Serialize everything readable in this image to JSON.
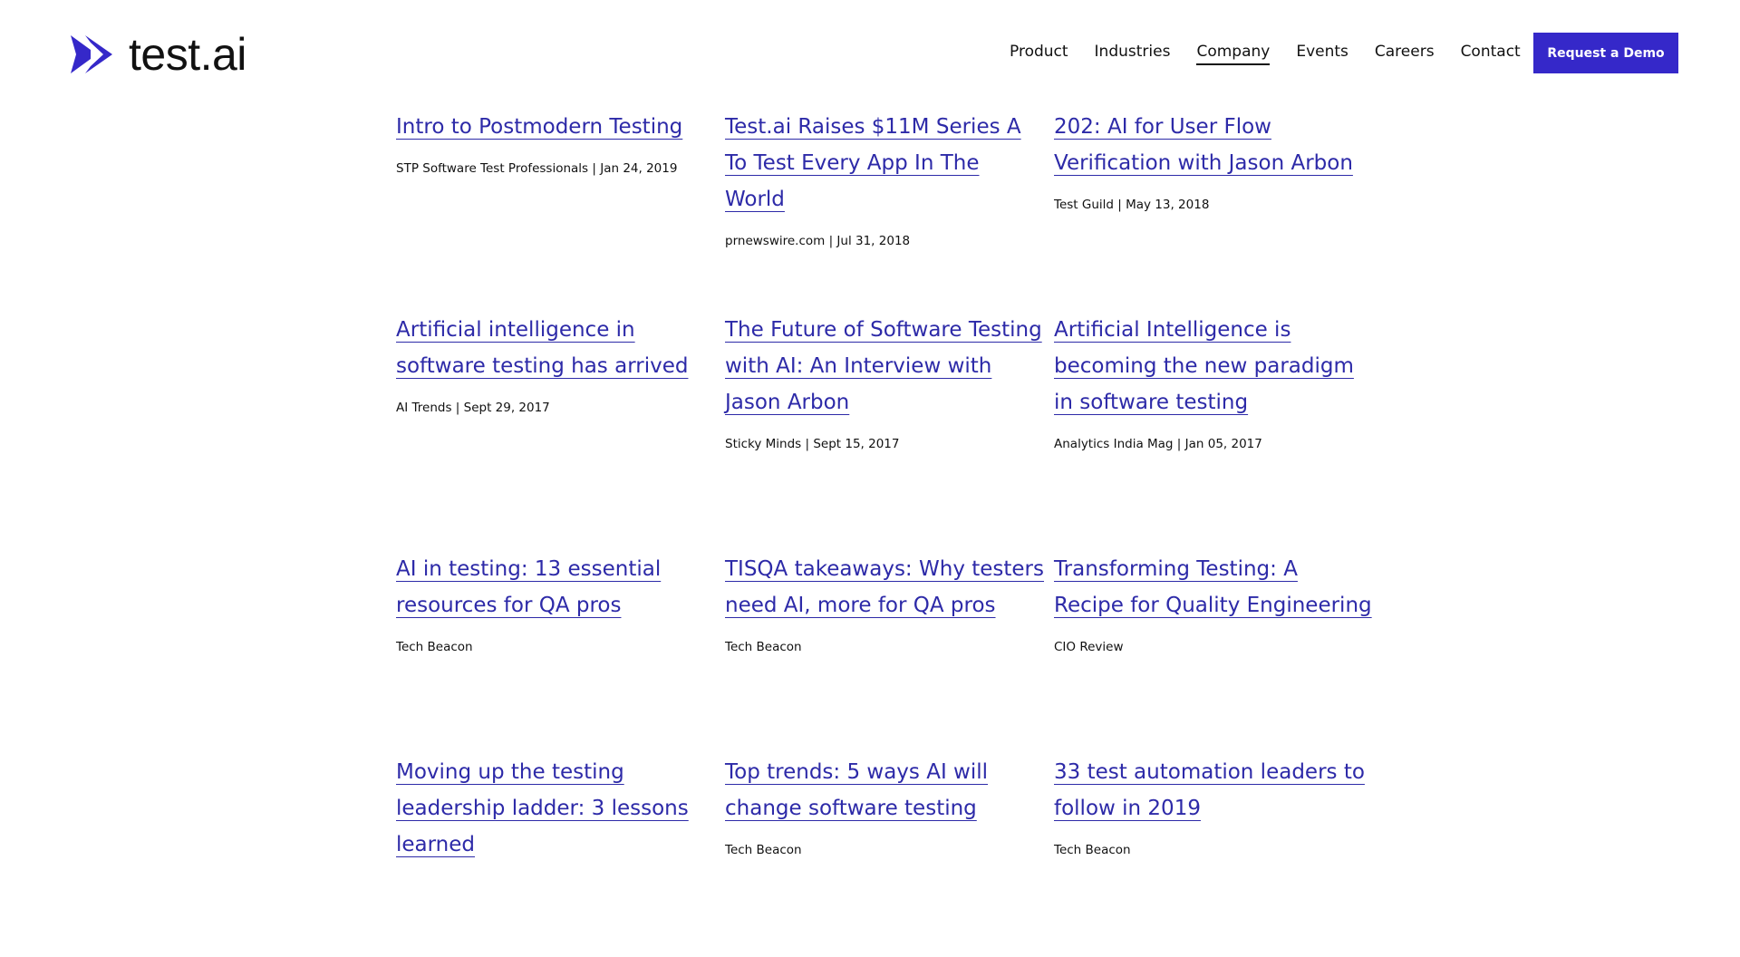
{
  "brand": {
    "name": "test.ai",
    "primary_color": "#3528c9",
    "link_color": "#2d2aa8"
  },
  "nav": {
    "items": [
      {
        "label": "Product",
        "active": false
      },
      {
        "label": "Industries",
        "active": false
      },
      {
        "label": "Company",
        "active": true
      },
      {
        "label": "Events",
        "active": false
      },
      {
        "label": "Careers",
        "active": false
      },
      {
        "label": "Contact",
        "active": false
      }
    ],
    "cta_label": "Request a Demo"
  },
  "articles": [
    {
      "title": "Intro to Postmodern Testing",
      "meta": "STP Software Test Professionals  |  Jan 24, 2019"
    },
    {
      "title": "Test.ai Raises $11M Series A To Test Every App In The World",
      "meta": "prnewswire.com  |  Jul 31, 2018"
    },
    {
      "title": "202: AI for User Flow Verification with Jason Arbon",
      "meta": "Test Guild | May 13, 2018"
    },
    {
      "title": "Artificial intelligence in software testing has arrived",
      "meta": "AI Trends  |  Sept 29, 2017"
    },
    {
      "title": "The Future of Software Testing with AI: An Interview with Jason Arbon",
      "meta": "Sticky Minds  | Sept 15, 2017"
    },
    {
      "title": "Artificial Intelligence is becoming the new paradigm in software testing",
      "meta": "Analytics India Mag | Jan 05, 2017"
    },
    {
      "title": "AI in testing: 13 essential resources for QA pros",
      "meta": "Tech Beacon"
    },
    {
      "title": "TISQA takeaways: Why testers need AI, more for QA pros",
      "meta": "Tech Beacon"
    },
    {
      "title": "Transforming Testing: A Recipe for Quality Engineering",
      "meta": "CIO Review"
    },
    {
      "title": "Moving up the testing leadership ladder: 3 lessons learned",
      "meta": ""
    },
    {
      "title": "Top trends: 5 ways AI will change software testing",
      "meta": "Tech Beacon"
    },
    {
      "title": "33 test automation leaders to follow in 2019",
      "meta": "Tech Beacon"
    }
  ]
}
